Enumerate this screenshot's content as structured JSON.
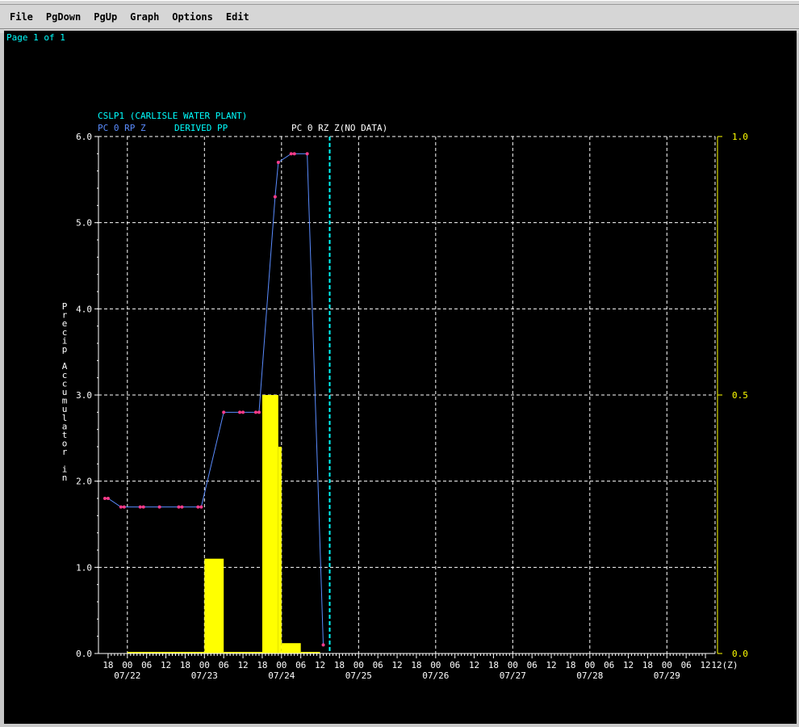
{
  "menu": {
    "items": [
      {
        "label": "File"
      },
      {
        "label": "PgDown"
      },
      {
        "label": "PgUp"
      },
      {
        "label": "Graph"
      },
      {
        "label": "Options"
      },
      {
        "label": "Edit"
      }
    ]
  },
  "page_indicator": "Page 1 of 1",
  "colors": {
    "background": "#000000",
    "axis": "#ffffff",
    "grid": "#ffffff",
    "title": "#00ffff",
    "line_series": "#5a8cff",
    "line_markers": "#ff3b8a",
    "bars": "#ffff00",
    "right_axis": "#ffff00",
    "nodata_label": "#ffffff",
    "current_time": "#00ffff"
  },
  "chart_data": {
    "type": "bar+line",
    "title": "CSLP1 (CARLISLE WATER PLANT)",
    "legend": [
      {
        "label": "PC 0 RP Z",
        "color": "#5a8cff"
      },
      {
        "label": "DERIVED PP",
        "color": "#00ffff"
      },
      {
        "label": "PC 0 RZ Z(NO DATA)",
        "color": "#ffffff"
      }
    ],
    "ylabel": "Precip Accumulator in",
    "ylim": [
      0,
      6
    ],
    "yticks": [
      "0.0",
      "1.0",
      "2.0",
      "3.0",
      "4.0",
      "5.0",
      "6.0"
    ],
    "y2lim": [
      0,
      1
    ],
    "y2ticks": [
      "0.0",
      "0.5",
      "1.0"
    ],
    "x_hour_labels": [
      "18",
      "00",
      "06",
      "12",
      "18",
      "00",
      "06",
      "12",
      "18",
      "00",
      "06",
      "12",
      "18",
      "00",
      "06",
      "12",
      "18",
      "00",
      "06",
      "12",
      "18",
      "00",
      "06",
      "12",
      "18",
      "00",
      "06",
      "12",
      "18",
      "00",
      "06",
      "12",
      "12(Z)"
    ],
    "x_date_labels": [
      "07/22",
      "07/23",
      "07/24",
      "07/25",
      "07/26",
      "07/27",
      "07/28",
      "07/29"
    ],
    "x_hours_range": [
      -9,
      183
    ],
    "current_time_hour": 63,
    "accumulator": [
      {
        "h": -7,
        "v": 1.8
      },
      {
        "h": -6,
        "v": 1.8
      },
      {
        "h": -2,
        "v": 1.7
      },
      {
        "h": -1,
        "v": 1.7
      },
      {
        "h": 4,
        "v": 1.7
      },
      {
        "h": 5,
        "v": 1.7
      },
      {
        "h": 10,
        "v": 1.7
      },
      {
        "h": 16,
        "v": 1.7
      },
      {
        "h": 17,
        "v": 1.7
      },
      {
        "h": 22,
        "v": 1.7
      },
      {
        "h": 23,
        "v": 1.7
      },
      {
        "h": 30,
        "v": 2.8
      },
      {
        "h": 35,
        "v": 2.8
      },
      {
        "h": 36,
        "v": 2.8
      },
      {
        "h": 40,
        "v": 2.8
      },
      {
        "h": 41,
        "v": 2.8
      },
      {
        "h": 46,
        "v": 5.3
      },
      {
        "h": 47,
        "v": 5.7
      },
      {
        "h": 51,
        "v": 5.8
      },
      {
        "h": 52,
        "v": 5.8
      },
      {
        "h": 56,
        "v": 5.8
      },
      {
        "h": 61,
        "v": 0.1
      }
    ],
    "derived_pp": [
      {
        "start": 0,
        "end": 24,
        "v": 0.0
      },
      {
        "start": 24,
        "end": 30,
        "v": 1.1
      },
      {
        "start": 30,
        "end": 42,
        "v": 0.0
      },
      {
        "start": 42,
        "end": 47,
        "v": 3.0
      },
      {
        "start": 47,
        "end": 48,
        "v": 2.4
      },
      {
        "start": 48,
        "end": 54,
        "v": 0.12
      },
      {
        "start": 54,
        "end": 60,
        "v": 0.0
      }
    ]
  }
}
